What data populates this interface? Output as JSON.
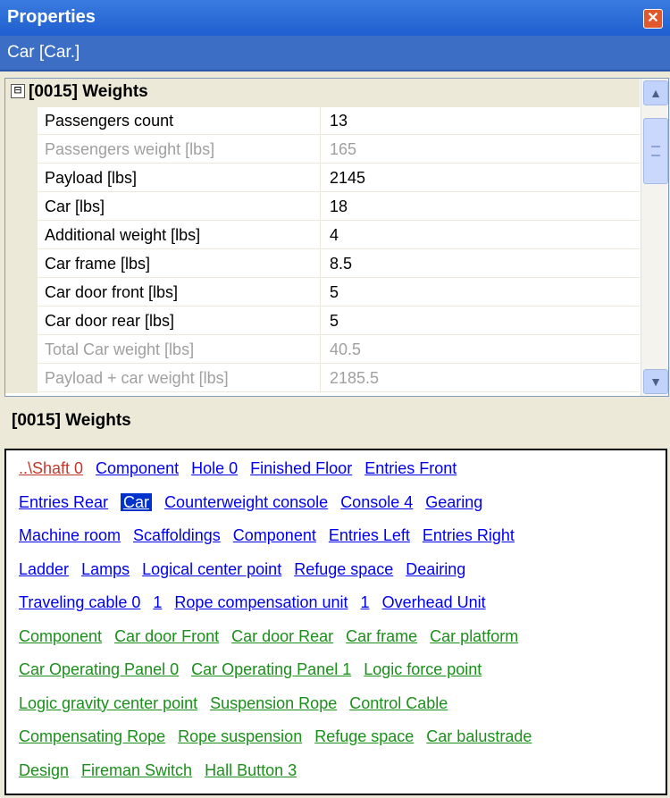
{
  "window": {
    "title": "Properties",
    "close_glyph": "✕"
  },
  "object_label": "Car [Car.]",
  "category": {
    "expander": "⊟",
    "label": "[0015] Weights"
  },
  "rows": [
    {
      "name": "Passengers count",
      "value": "13",
      "readonly": false
    },
    {
      "name": "Passengers weight [lbs]",
      "value": "165",
      "readonly": true
    },
    {
      "name": "Payload [lbs]",
      "value": "2145",
      "readonly": false
    },
    {
      "name": "Car [lbs]",
      "value": "18",
      "readonly": false
    },
    {
      "name": "Additional weight [lbs]",
      "value": "4",
      "readonly": false
    },
    {
      "name": "Car frame [lbs]",
      "value": "8.5",
      "readonly": false
    },
    {
      "name": "Car door front [lbs]",
      "value": "5",
      "readonly": false
    },
    {
      "name": "Car door rear [lbs]",
      "value": "5",
      "readonly": false
    },
    {
      "name": "Total Car weight [lbs]",
      "value": "40.5",
      "readonly": true
    },
    {
      "name": "Payload + car weight [lbs]",
      "value": "2185.5",
      "readonly": true
    }
  ],
  "scrollbar": {
    "up_glyph": "▲",
    "down_glyph": "▼"
  },
  "description": "[0015] Weights",
  "link_lines": [
    [
      {
        "t": "..\\Shaft 0",
        "c": "red"
      },
      {
        "t": "Component",
        "c": "blue"
      },
      {
        "t": "Hole 0",
        "c": "blue"
      },
      {
        "t": "Finished Floor",
        "c": "blue"
      },
      {
        "t": "Entries Front",
        "c": "blue"
      }
    ],
    [
      {
        "t": "Entries Rear",
        "c": "blue"
      },
      {
        "t": "Car",
        "c": "sel"
      },
      {
        "t": "Counterweight console",
        "c": "blue"
      },
      {
        "t": "Console 4",
        "c": "blue"
      },
      {
        "t": "Gearing",
        "c": "blue"
      }
    ],
    [
      {
        "t": "Machine room",
        "c": "blue"
      },
      {
        "t": "Scaffoldings",
        "c": "blue"
      },
      {
        "t": "Component",
        "c": "blue"
      },
      {
        "t": "Entries Left",
        "c": "blue"
      },
      {
        "t": "Entries Right",
        "c": "blue"
      }
    ],
    [
      {
        "t": "Ladder",
        "c": "blue"
      },
      {
        "t": "Lamps",
        "c": "blue"
      },
      {
        "t": "Logical center point",
        "c": "blue"
      },
      {
        "t": "Refuge space",
        "c": "blue"
      },
      {
        "t": "Deairing",
        "c": "blue"
      }
    ],
    [
      {
        "t": "Traveling cable 0",
        "c": "blue"
      },
      {
        "t": "1",
        "c": "blue"
      },
      {
        "t": "Rope compensation unit",
        "c": "blue"
      },
      {
        "t": "1",
        "c": "blue"
      },
      {
        "t": "Overhead Unit",
        "c": "blue"
      }
    ],
    [
      {
        "t": "Component",
        "c": "green"
      },
      {
        "t": "Car door Front",
        "c": "green"
      },
      {
        "t": "Car door Rear",
        "c": "green"
      },
      {
        "t": "Car frame",
        "c": "green"
      },
      {
        "t": "Car platform",
        "c": "green"
      }
    ],
    [
      {
        "t": "Car Operating Panel 0",
        "c": "green"
      },
      {
        "t": "Car Operating Panel 1",
        "c": "green"
      },
      {
        "t": "Logic force point",
        "c": "green"
      }
    ],
    [
      {
        "t": "Logic gravity center point",
        "c": "green"
      },
      {
        "t": "Suspension Rope",
        "c": "green"
      },
      {
        "t": "Control Cable",
        "c": "green"
      }
    ],
    [
      {
        "t": "Compensating Rope",
        "c": "green"
      },
      {
        "t": "Rope suspension",
        "c": "green"
      },
      {
        "t": "Refuge space",
        "c": "green"
      },
      {
        "t": "Car balustrade",
        "c": "green"
      }
    ],
    [
      {
        "t": "Design",
        "c": "green"
      },
      {
        "t": "Fireman Switch",
        "c": "green"
      },
      {
        "t": "Hall Button 3",
        "c": "green"
      }
    ]
  ]
}
